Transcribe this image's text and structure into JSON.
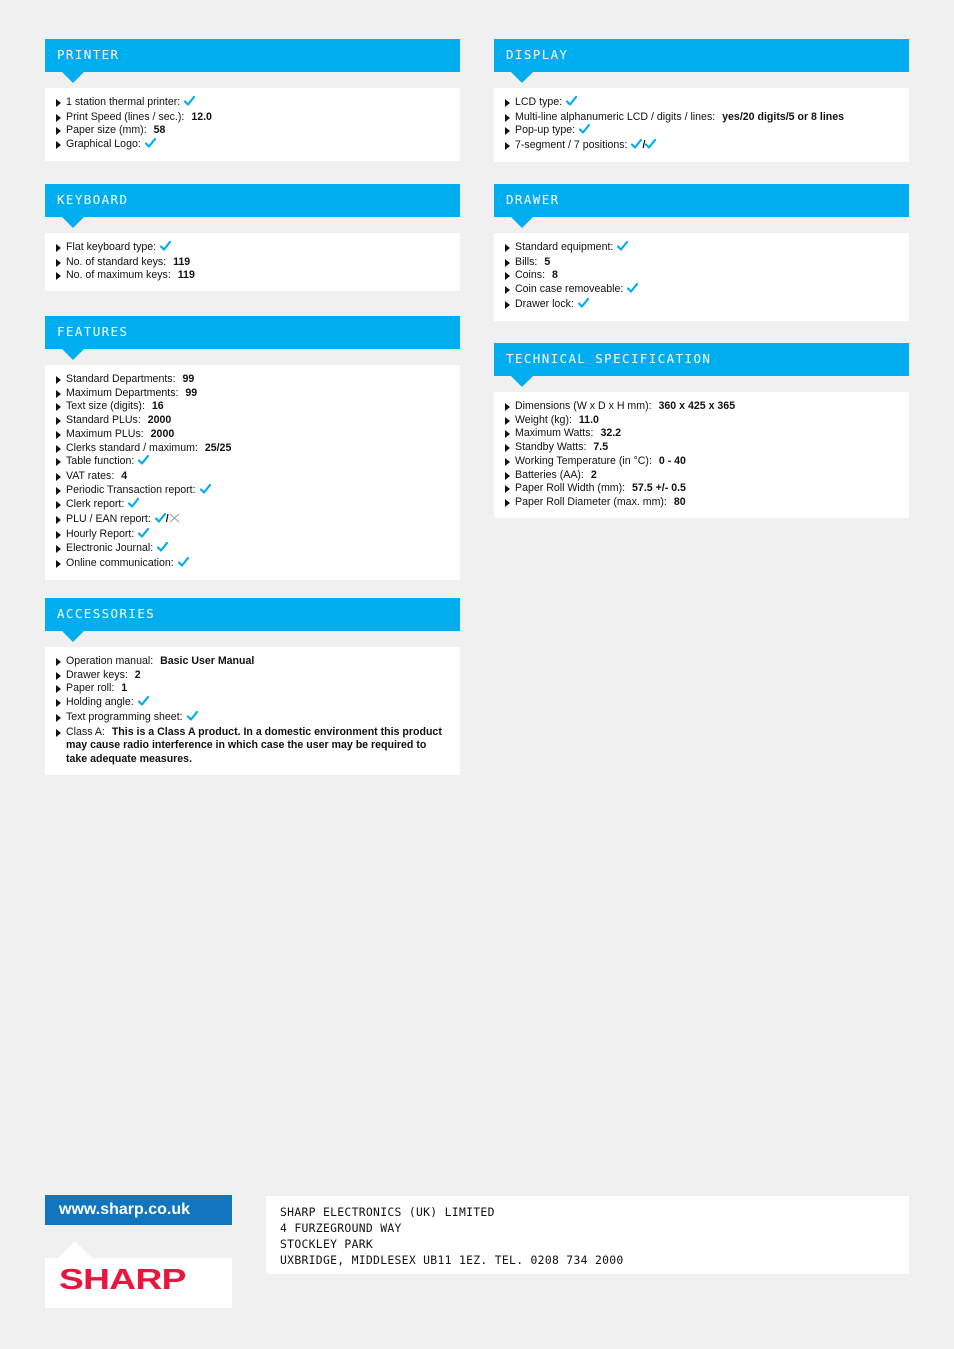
{
  "colors": {
    "header_bg": "#00aeef",
    "check": "#00aeef",
    "url_bar": "#1276be",
    "logo": "#e8163c",
    "page_bg": "#f0f0f0"
  },
  "sections": {
    "printer": {
      "title": "PRINTER",
      "items": [
        {
          "label": "1 station thermal printer:",
          "value": null,
          "icon": "check-icon"
        },
        {
          "label": "Print Speed (lines / sec.):",
          "value": "12.0"
        },
        {
          "label": "Paper size (mm):",
          "value": "58"
        },
        {
          "label": "Graphical Logo:",
          "value": null,
          "icon": "check-icon"
        }
      ]
    },
    "display": {
      "title": "DISPLAY",
      "items": [
        {
          "label": "LCD type:",
          "icon": "check-icon"
        },
        {
          "label": "Multi-line alphanumeric LCD / digits / lines:",
          "value": "yes/20 digits/5 or 8 lines"
        },
        {
          "label": "Pop-up type:",
          "icon": "check-icon"
        },
        {
          "label": "7-segment / 7 positions:",
          "icon": "check-icon",
          "separator": "/",
          "icon2": "check-icon"
        }
      ]
    },
    "keyboard": {
      "title": "KEYBOARD",
      "items": [
        {
          "label": "Flat keyboard type:",
          "icon": "check-icon"
        },
        {
          "label": "No. of standard keys:",
          "value": "119"
        },
        {
          "label": "No. of maximum keys:",
          "value": "119"
        }
      ]
    },
    "drawer": {
      "title": "DRAWER",
      "items": [
        {
          "label": "Standard equipment:",
          "icon": "check-icon"
        },
        {
          "label": "Bills:",
          "value": "5"
        },
        {
          "label": "Coins:",
          "value": "8"
        },
        {
          "label": "Coin case removeable:",
          "icon": "check-icon"
        },
        {
          "label": "Drawer lock:",
          "icon": "check-icon"
        }
      ]
    },
    "features": {
      "title": "FEATURES",
      "items": [
        {
          "label": "Standard Departments:",
          "value": "99"
        },
        {
          "label": "Maximum Departments:",
          "value": "99"
        },
        {
          "label": "Text size (digits):",
          "value": "16"
        },
        {
          "label": "Standard PLUs:",
          "value": "2000"
        },
        {
          "label": "Maximum PLUs:",
          "value": "2000"
        },
        {
          "label": "Clerks standard / maximum:",
          "value": "25/25"
        },
        {
          "label": "Table function:",
          "icon": "check-icon"
        },
        {
          "label": "VAT rates:",
          "value": "4"
        },
        {
          "label": "Periodic Transaction report:",
          "icon": "check-icon"
        },
        {
          "label": "Clerk report:",
          "icon": "check-icon"
        },
        {
          "label": "PLU / EAN report:",
          "icon": "check-icon",
          "separator": "/",
          "icon2": "cross-icon"
        },
        {
          "label": "Hourly Report:",
          "icon": "check-icon"
        },
        {
          "label": "Electronic Journal:",
          "icon": "check-icon"
        },
        {
          "label": "Online communication:",
          "icon": "check-icon"
        }
      ]
    },
    "technical": {
      "title": "TECHNICAL SPECIFICATION",
      "items": [
        {
          "label": "Dimensions (W x D x H mm):",
          "value": "360 x 425 x 365"
        },
        {
          "label": "Weight (kg):",
          "value": "11.0"
        },
        {
          "label": "Maximum Watts:",
          "value": "32.2"
        },
        {
          "label": "Standby Watts:",
          "value": "7.5"
        },
        {
          "label": "Working Temperature (in °C):",
          "value": "0 - 40"
        },
        {
          "label": "Batteries (AA):",
          "value": "2"
        },
        {
          "label": "Paper Roll Width (mm):",
          "value": "57.5 +/- 0.5"
        },
        {
          "label": "Paper Roll Diameter (max. mm):",
          "value": "80"
        }
      ]
    },
    "accessories": {
      "title": "ACCESSORIES",
      "items": [
        {
          "label": "Operation manual:",
          "value": "Basic User Manual"
        },
        {
          "label": "Drawer keys:",
          "value": "2"
        },
        {
          "label": "Paper roll:",
          "value": "1"
        },
        {
          "label": "Holding angle:",
          "icon": "check-icon"
        },
        {
          "label": "Text programming sheet:",
          "icon": "check-icon"
        },
        {
          "label": "Class A:",
          "value": "This is a Class A product. In a domestic environment this product may cause radio interference in which case the user may be required to take adequate measures."
        }
      ]
    }
  },
  "footer": {
    "url": "www.sharp.co.uk",
    "logo_text": "SHARP",
    "address_lines": [
      "SHARP ELECTRONICS (UK) LIMITED",
      "4 FURZEGROUND WAY",
      "STOCKLEY PARK",
      "UXBRIDGE, MIDDLESEX UB11 1EZ. TEL. 0208 734 2000"
    ]
  }
}
